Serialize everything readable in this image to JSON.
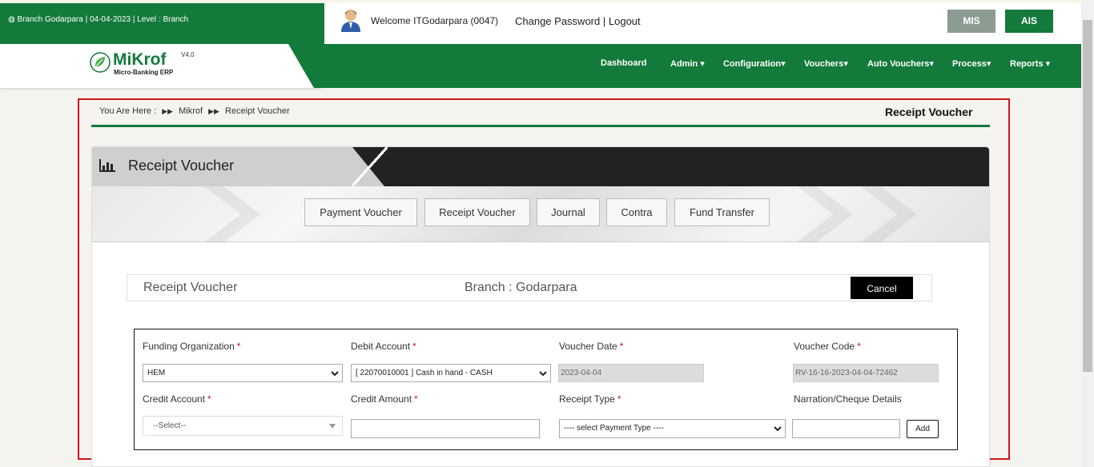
{
  "header": {
    "branch_info": "Branch Godarpara |  04-04-2023 | Level : Branch",
    "welcome": "Welcome ITGodarpara (0047)",
    "change_password": "Change Password",
    "separator": "|",
    "logout": "Logout",
    "mis_label": "MIS",
    "ais_label": "AIS"
  },
  "logo": {
    "name": "MiKrof",
    "version": "V4.0",
    "subtitle": "Micro-Banking ERP"
  },
  "nav": {
    "items": [
      {
        "label": "Dashboard"
      },
      {
        "label": "Admin"
      },
      {
        "label": "Configuration"
      },
      {
        "label": "Vouchers"
      },
      {
        "label": "Auto Vouchers"
      },
      {
        "label": "Process"
      },
      {
        "label": "Reports"
      }
    ]
  },
  "breadcrumb": {
    "you_are_here": "You Are Here   :",
    "level1": "Mikrof",
    "level2": "Receipt Voucher"
  },
  "page_title": "Receipt Voucher",
  "panel": {
    "title": "Receipt Voucher",
    "tabs": [
      {
        "label": "Payment Voucher"
      },
      {
        "label": "Receipt Voucher"
      },
      {
        "label": "Journal"
      },
      {
        "label": "Contra"
      },
      {
        "label": "Fund Transfer"
      }
    ]
  },
  "form_header": {
    "title": "Receipt Voucher",
    "branch": "Branch : Godarpara",
    "cancel_label": "Cancel"
  },
  "form": {
    "funding_org": {
      "label": "Funding Organization",
      "value": "HEM"
    },
    "debit_account": {
      "label": "Debit Account",
      "value": "[ 22070010001 ] Cash in hand - CASH"
    },
    "voucher_date": {
      "label": "Voucher Date",
      "value": "2023-04-04"
    },
    "voucher_code": {
      "label": "Voucher Code",
      "value": "RV-16-16-2023-04-04-72462"
    },
    "credit_account": {
      "label": "Credit Account",
      "value": "--Select--"
    },
    "credit_amount": {
      "label": "Credit Amount",
      "value": ""
    },
    "receipt_type": {
      "label": "Receipt Type",
      "value": "---- select Payment Type ----"
    },
    "narration": {
      "label": "Narration/Cheque Details",
      "value": ""
    },
    "add_label": "Add",
    "required_mark": "*"
  },
  "colors": {
    "brand_green": "#137a3c",
    "required_red": "#d0151a",
    "frame_red": "#d0151a"
  }
}
